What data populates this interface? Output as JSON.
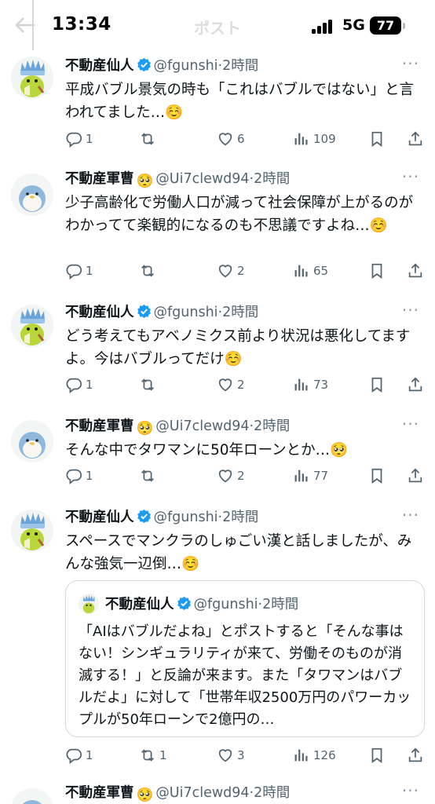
{
  "status_bar": {
    "time": "13:34",
    "network": "5G",
    "battery": "77",
    "ghost_title": "ポスト"
  },
  "icons": {
    "reply": "reply-icon",
    "retweet": "retweet-icon",
    "like": "heart-icon",
    "views": "views-icon",
    "bookmark": "bookmark-icon",
    "share": "share-icon",
    "verified": "verified-badge-icon",
    "more": "more-icon"
  },
  "colors": {
    "verified_blue": "#1d9bf0",
    "secondary_text": "#536471",
    "thread_line": "#cfd9de"
  },
  "posts": [
    {
      "name": "不動産仙人",
      "verified": true,
      "handle": "@fgunshi",
      "time": "2時間",
      "text": "平成バブル景気の時も「これはバブルではない」と言われてました…☺️",
      "replies": "1",
      "retweets": "",
      "likes": "6",
      "views": "109"
    },
    {
      "name": "不動産軍曹",
      "name_emoji": "🥺",
      "handle": "@Ui7clewd94",
      "time": "2時間",
      "text": "少子高齢化で労働人口が減って社会保障が上がるのがわかってて楽観的になるのも不思議ですよね…☺️",
      "replies": "1",
      "retweets": "",
      "likes": "2",
      "views": "65"
    },
    {
      "name": "不動産仙人",
      "verified": true,
      "handle": "@fgunshi",
      "time": "2時間",
      "text": "どう考えてもアベノミクス前より状況は悪化してますよ。今はバブルってだけ☺️",
      "replies": "1",
      "retweets": "",
      "likes": "2",
      "views": "73"
    },
    {
      "name": "不動産軍曹",
      "name_emoji": "🥺",
      "handle": "@Ui7clewd94",
      "time": "2時間",
      "text": "そんな中でタワマンに50年ローンとか…🥺",
      "replies": "1",
      "retweets": "",
      "likes": "2",
      "views": "77"
    },
    {
      "name": "不動産仙人",
      "verified": true,
      "handle": "@fgunshi",
      "time": "2時間",
      "text": "スペースでマンクラのしゅごい漢と話しましたが、みんな強気一辺倒…☺️",
      "quote": {
        "name": "不動産仙人",
        "verified": true,
        "handle": "@fgunshi",
        "time": "2時間",
        "text": "「AIはバブルだよね」とポストすると「そんな事はない！シンギュラリティが来て、労働そのものが消滅する！」と反論が来ます。また「タワマンはバブルだよ」に対して「世帯年収2500万円のパワーカップルが50年ローンで2億円の…"
      },
      "replies": "1",
      "retweets": "1",
      "likes": "3",
      "views": "126"
    },
    {
      "name": "不動産軍曹",
      "name_emoji": "🥺",
      "handle": "@Ui7clewd94",
      "time": "2時間"
    }
  ]
}
